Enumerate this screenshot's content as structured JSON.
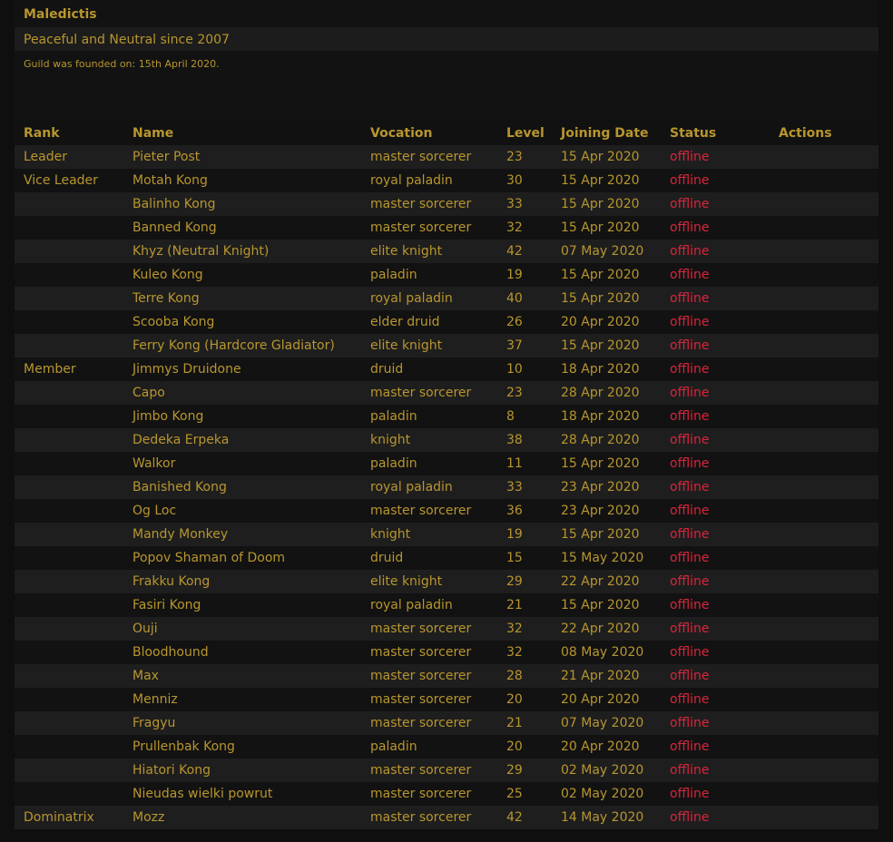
{
  "guild": {
    "name": "Maledictis",
    "description": "Peaceful and Neutral since 2007",
    "founded": "Guild was founded on: 15th April 2020."
  },
  "table": {
    "headers": [
      "Rank",
      "Name",
      "Vocation",
      "Level",
      "Joining Date",
      "Status",
      "Actions"
    ],
    "rows": [
      {
        "rank": "Leader",
        "name": "Pieter Post",
        "vocation": "master sorcerer",
        "level": "23",
        "date": "15 Apr 2020",
        "status": "offline"
      },
      {
        "rank": "Vice Leader",
        "name": "Motah Kong",
        "vocation": "royal paladin",
        "level": "30",
        "date": "15 Apr 2020",
        "status": "offline"
      },
      {
        "rank": "",
        "name": "Balinho Kong",
        "vocation": "master sorcerer",
        "level": "33",
        "date": "15 Apr 2020",
        "status": "offline"
      },
      {
        "rank": "",
        "name": "Banned Kong",
        "vocation": "master sorcerer",
        "level": "32",
        "date": "15 Apr 2020",
        "status": "offline"
      },
      {
        "rank": "",
        "name": "Khyz (Neutral Knight)",
        "vocation": "elite knight",
        "level": "42",
        "date": "07 May 2020",
        "status": "offline"
      },
      {
        "rank": "",
        "name": "Kuleo Kong",
        "vocation": "paladin",
        "level": "19",
        "date": "15 Apr 2020",
        "status": "offline"
      },
      {
        "rank": "",
        "name": "Terre Kong",
        "vocation": "royal paladin",
        "level": "40",
        "date": "15 Apr 2020",
        "status": "offline"
      },
      {
        "rank": "",
        "name": "Scooba Kong",
        "vocation": "elder druid",
        "level": "26",
        "date": "20 Apr 2020",
        "status": "offline"
      },
      {
        "rank": "",
        "name": "Ferry Kong (Hardcore Gladiator)",
        "vocation": "elite knight",
        "level": "37",
        "date": "15 Apr 2020",
        "status": "offline"
      },
      {
        "rank": "Member",
        "name": "Jimmys Druidone",
        "vocation": "druid",
        "level": "10",
        "date": "18 Apr 2020",
        "status": "offline"
      },
      {
        "rank": "",
        "name": "Capo",
        "vocation": "master sorcerer",
        "level": "23",
        "date": "28 Apr 2020",
        "status": "offline"
      },
      {
        "rank": "",
        "name": "Jimbo Kong",
        "vocation": "paladin",
        "level": "8",
        "date": "18 Apr 2020",
        "status": "offline"
      },
      {
        "rank": "",
        "name": "Dedeka Erpeka",
        "vocation": "knight",
        "level": "38",
        "date": "28 Apr 2020",
        "status": "offline"
      },
      {
        "rank": "",
        "name": "Walkor",
        "vocation": "paladin",
        "level": "11",
        "date": "15 Apr 2020",
        "status": "offline"
      },
      {
        "rank": "",
        "name": "Banished Kong",
        "vocation": "royal paladin",
        "level": "33",
        "date": "23 Apr 2020",
        "status": "offline"
      },
      {
        "rank": "",
        "name": "Og Loc",
        "vocation": "master sorcerer",
        "level": "36",
        "date": "23 Apr 2020",
        "status": "offline"
      },
      {
        "rank": "",
        "name": "Mandy Monkey",
        "vocation": "knight",
        "level": "19",
        "date": "15 Apr 2020",
        "status": "offline"
      },
      {
        "rank": "",
        "name": "Popov Shaman of Doom",
        "vocation": "druid",
        "level": "15",
        "date": "15 May 2020",
        "status": "offline"
      },
      {
        "rank": "",
        "name": "Frakku Kong",
        "vocation": "elite knight",
        "level": "29",
        "date": "22 Apr 2020",
        "status": "offline"
      },
      {
        "rank": "",
        "name": "Fasiri Kong",
        "vocation": "royal paladin",
        "level": "21",
        "date": "15 Apr 2020",
        "status": "offline"
      },
      {
        "rank": "",
        "name": "Ouji",
        "vocation": "master sorcerer",
        "level": "32",
        "date": "22 Apr 2020",
        "status": "offline"
      },
      {
        "rank": "",
        "name": "Bloodhound",
        "vocation": "master sorcerer",
        "level": "32",
        "date": "08 May 2020",
        "status": "offline"
      },
      {
        "rank": "",
        "name": "Max",
        "vocation": "master sorcerer",
        "level": "28",
        "date": "21 Apr 2020",
        "status": "offline"
      },
      {
        "rank": "",
        "name": "Menniz",
        "vocation": "master sorcerer",
        "level": "20",
        "date": "20 Apr 2020",
        "status": "offline"
      },
      {
        "rank": "",
        "name": "Fragyu",
        "vocation": "master sorcerer",
        "level": "21",
        "date": "07 May 2020",
        "status": "offline"
      },
      {
        "rank": "",
        "name": "Prullenbak Kong",
        "vocation": "paladin",
        "level": "20",
        "date": "20 Apr 2020",
        "status": "offline"
      },
      {
        "rank": "",
        "name": "Hiatori Kong",
        "vocation": "master sorcerer",
        "level": "29",
        "date": "02 May 2020",
        "status": "offline"
      },
      {
        "rank": "",
        "name": "Nieudas wielki powrut",
        "vocation": "master sorcerer",
        "level": "25",
        "date": "02 May 2020",
        "status": "offline"
      },
      {
        "rank": "Dominatrix",
        "name": "Mozz",
        "vocation": "master sorcerer",
        "level": "42",
        "date": "14 May 2020",
        "status": "offline"
      }
    ]
  },
  "colors": {
    "text": "#b8962e",
    "status_offline": "#d7263d",
    "background": "#0f0f0f"
  }
}
